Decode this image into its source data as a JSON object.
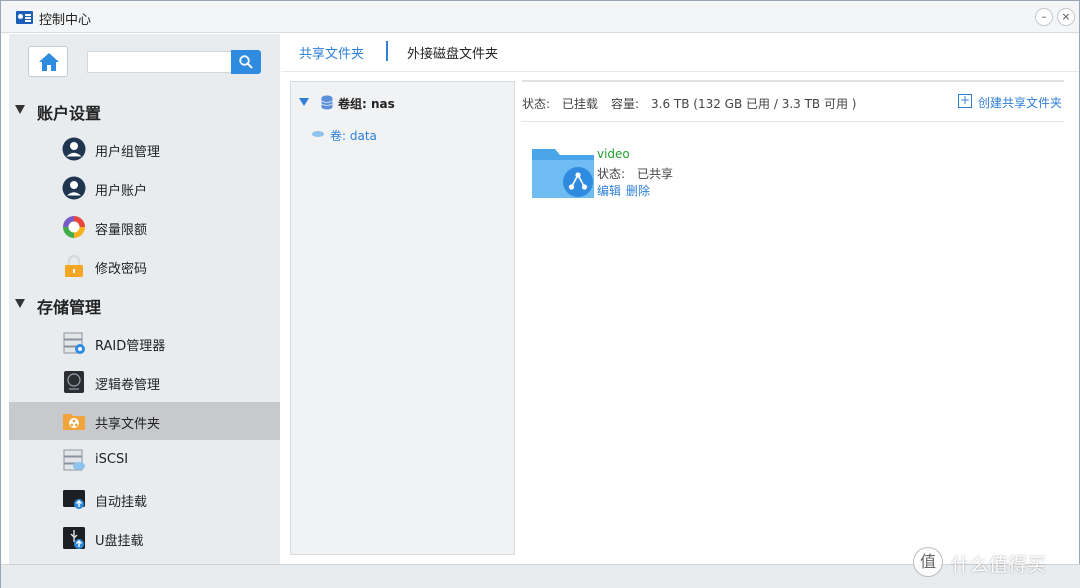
{
  "window": {
    "title": "控制中心"
  },
  "sidebar": {
    "search": {
      "value": "",
      "placeholder": ""
    },
    "sections": [
      {
        "label": "账户设置",
        "items": [
          {
            "label": "用户组管理",
            "icon": "user-group-icon"
          },
          {
            "label": "用户账户",
            "icon": "user-account-icon"
          },
          {
            "label": "容量限额",
            "icon": "quota-pie-icon"
          },
          {
            "label": "修改密码",
            "icon": "lock-icon"
          }
        ]
      },
      {
        "label": "存储管理",
        "items": [
          {
            "label": "RAID管理器",
            "icon": "raid-disk-icon"
          },
          {
            "label": "逻辑卷管理",
            "icon": "logical-volume-icon"
          },
          {
            "label": "共享文件夹",
            "icon": "shared-folder-icon",
            "active": true
          },
          {
            "label": "iSCSI",
            "icon": "iscsi-icon"
          },
          {
            "label": "自动挂载",
            "icon": "auto-mount-icon"
          },
          {
            "label": "U盘挂载",
            "icon": "usb-mount-icon"
          }
        ]
      }
    ]
  },
  "tabs": [
    {
      "label": "共享文件夹",
      "active": true
    },
    {
      "label": "外接磁盘文件夹",
      "active": false
    }
  ],
  "tree": {
    "volume_group": "卷组: nas",
    "volume": "卷: data"
  },
  "info": {
    "status_key": "状态:",
    "status_value": "已挂载",
    "capacity_key": "容量:",
    "capacity_value": "3.6 TB (132 GB 已用 / 3.3 TB 可用 )",
    "create_label": "创建共享文件夹"
  },
  "folders": [
    {
      "name": "video",
      "status_key": "状态:",
      "status_value": "已共享",
      "edit": "编辑",
      "delete": "删除"
    }
  ],
  "watermark": {
    "symbol": "值",
    "text": "什么值得买"
  },
  "colors": {
    "accent": "#2f7fd6",
    "folder_name": "#22a02a",
    "active_nav": "#c7c9cc",
    "sidebar_bg": "#e9ecef"
  }
}
